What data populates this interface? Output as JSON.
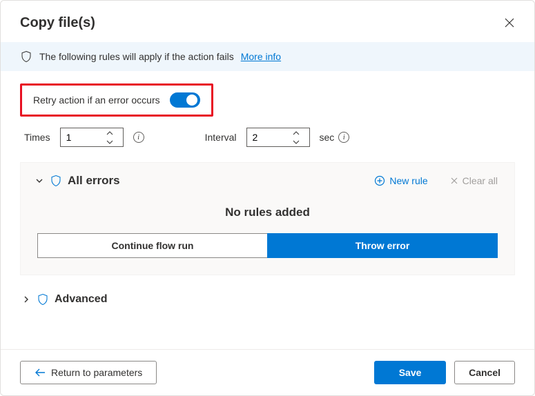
{
  "title": "Copy file(s)",
  "banner": {
    "text": "The following rules will apply if the action fails",
    "link": "More info"
  },
  "retry": {
    "label": "Retry action if an error occurs",
    "enabled": true,
    "times_label": "Times",
    "times_value": "1",
    "interval_label": "Interval",
    "interval_value": "2",
    "interval_unit": "sec"
  },
  "errors": {
    "title": "All errors",
    "new_rule": "New rule",
    "clear_all": "Clear all",
    "empty": "No rules added",
    "continue": "Continue flow run",
    "throw": "Throw error"
  },
  "advanced": "Advanced",
  "footer": {
    "return": "Return to parameters",
    "save": "Save",
    "cancel": "Cancel"
  }
}
